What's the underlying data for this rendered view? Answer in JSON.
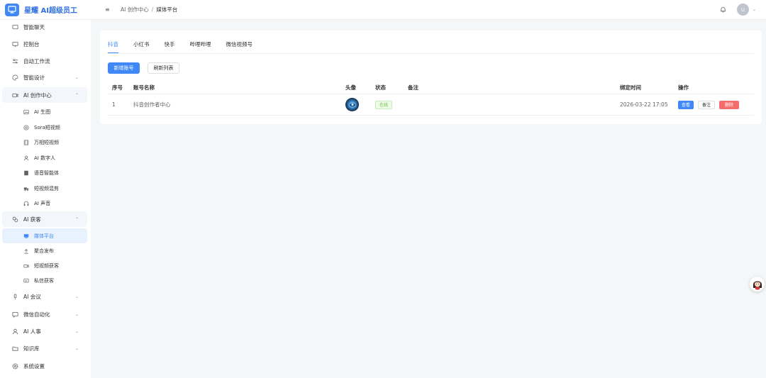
{
  "app": {
    "title": "星耀 AI超级员工"
  },
  "breadcrumb": {
    "parent": "AI 创作中心",
    "separator": "/",
    "current": "媒体平台"
  },
  "header": {
    "avatar_letter": "U"
  },
  "sidebar": {
    "items": [
      {
        "label": "智能聊天",
        "icon": "chat-icon"
      },
      {
        "label": "控制台",
        "icon": "monitor-icon"
      },
      {
        "label": "自动工作流",
        "icon": "sliders-icon"
      },
      {
        "label": "智能设计",
        "icon": "palette-icon",
        "expandable": true
      },
      {
        "label": "AI 创作中心",
        "icon": "video-icon",
        "expanded": true
      },
      {
        "label": "AI 获客",
        "icon": "share-icon",
        "expanded": true
      },
      {
        "label": "AI 会议",
        "icon": "microphone-icon",
        "expandable": true
      },
      {
        "label": "微信自动化",
        "icon": "message-icon",
        "expandable": true
      },
      {
        "label": "AI 人事",
        "icon": "user-icon",
        "expandable": true
      },
      {
        "label": "知识库",
        "icon": "folder-icon",
        "expandable": true
      },
      {
        "label": "系统设置",
        "icon": "gear-icon"
      }
    ],
    "creation_sub": [
      {
        "label": "AI 生图",
        "icon": "image-icon"
      },
      {
        "label": "Sora短视频",
        "icon": "aperture-icon"
      },
      {
        "label": "万相短视频",
        "icon": "film-icon"
      },
      {
        "label": "AI 数字人",
        "icon": "person-icon"
      },
      {
        "label": "语音智能体",
        "icon": "document-icon"
      },
      {
        "label": "短视频混剪",
        "icon": "truck-icon"
      },
      {
        "label": "AI 声音",
        "icon": "headphones-icon"
      }
    ],
    "acquire_sub": [
      {
        "label": "媒体平台",
        "icon": "monitor-solid-icon",
        "active": true
      },
      {
        "label": "聚合发布",
        "icon": "upload-icon"
      },
      {
        "label": "短视频获客",
        "icon": "camera-icon"
      },
      {
        "label": "私信获客",
        "icon": "chat-bubble-icon"
      }
    ]
  },
  "tabs": [
    {
      "label": "抖音",
      "active": true
    },
    {
      "label": "小红书"
    },
    {
      "label": "快手"
    },
    {
      "label": "哔哩哔哩"
    },
    {
      "label": "微信视频号"
    }
  ],
  "actions": {
    "add_label": "新增账号",
    "refresh_label": "刷新列表"
  },
  "table": {
    "headers": {
      "no": "序号",
      "name": "账号名称",
      "avatar": "头像",
      "status": "状态",
      "note": "备注",
      "bind_time": "绑定时间",
      "ops": "操作"
    },
    "rows": [
      {
        "no": "1",
        "name": "抖音创作者中心",
        "status": "在线",
        "note": "",
        "bind_time": "2026-03-22 17:05",
        "ops": {
          "view": "查看",
          "note": "备注",
          "delete": "删除"
        }
      }
    ]
  },
  "colors": {
    "accent": "#3f88f5",
    "success": "#67c23a",
    "danger": "#f56c6c"
  }
}
